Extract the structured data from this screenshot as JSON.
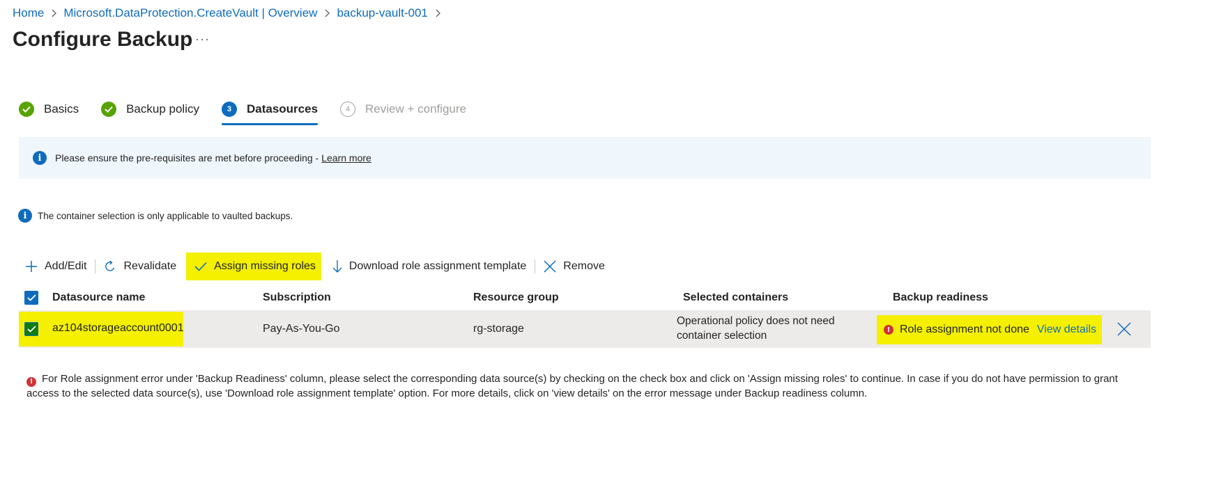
{
  "breadcrumb": [
    {
      "label": "Home"
    },
    {
      "label": "Microsoft.DataProtection.CreateVault | Overview"
    },
    {
      "label": "backup-vault-001"
    }
  ],
  "page": {
    "title": "Configure Backup",
    "more": "···"
  },
  "tabs": [
    {
      "label": "Basics",
      "state": "done"
    },
    {
      "label": "Backup policy",
      "state": "done"
    },
    {
      "label": "Datasources",
      "state": "current",
      "step": "3"
    },
    {
      "label": "Review + configure",
      "state": "future",
      "step": "4"
    }
  ],
  "banner": {
    "text": "Please ensure the pre-requisites are met before proceeding -",
    "link": "Learn more"
  },
  "note": {
    "text": "The container selection is only applicable to vaulted backups."
  },
  "toolbar": {
    "add_edit": "Add/Edit",
    "revalidate": "Revalidate",
    "assign_roles": "Assign missing roles",
    "download_template": "Download role assignment template",
    "remove": "Remove"
  },
  "table": {
    "headers": [
      "Datasource name",
      "Subscription",
      "Resource group",
      "Selected containers",
      "Backup readiness"
    ],
    "rows": [
      {
        "name": "az104storageaccount0001",
        "subscription": "Pay-As-You-Go",
        "resource_group": "rg-storage",
        "containers_line1": "Operational policy does not need",
        "containers_line2": "container selection",
        "readiness": "Role assignment not done",
        "details_link": "View details"
      }
    ]
  },
  "footer": {
    "text": "For Role assignment error under 'Backup Readiness' column, please select the corresponding data source(s) by checking on the check box and click on 'Assign missing roles' to continue. In case if you do not have permission to grant access to the selected data source(s), use 'Download role assignment template' option. For more details, click on 'view details' on the error message under Backup readiness column."
  },
  "colors": {
    "accent": "#0f6cbd",
    "success": "#57a300",
    "error": "#d13438",
    "highlight": "#f4f000",
    "banner_bg": "#eff6fc"
  },
  "icons": [
    "chevron-right-icon",
    "check-circle-icon",
    "info-icon",
    "add-icon",
    "refresh-icon",
    "checkmark-icon",
    "download-icon",
    "close-icon",
    "error-icon",
    "checkbox-icon"
  ]
}
